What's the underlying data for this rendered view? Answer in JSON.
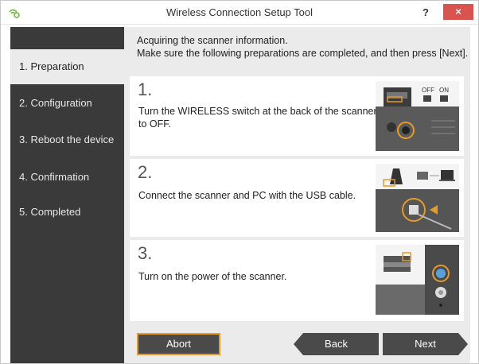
{
  "window": {
    "title": "Wireless Connection Setup Tool",
    "help_label": "?",
    "close_label": "×"
  },
  "sidebar": {
    "items": [
      {
        "label": "1. Preparation",
        "active": true
      },
      {
        "label": "2. Configuration",
        "active": false
      },
      {
        "label": "3. Reboot the device",
        "active": false
      },
      {
        "label": "4. Confirmation",
        "active": false
      },
      {
        "label": "5. Completed",
        "active": false
      }
    ]
  },
  "main": {
    "instruction_line1": "Acquiring the scanner information.",
    "instruction_line2": "Make sure the following preparations are completed, and then press [Next].",
    "steps": [
      {
        "number": "1.",
        "text": "Turn the WIRELESS switch at the back of the scanner to OFF.",
        "image_labels": {
          "off": "OFF",
          "on": "ON"
        }
      },
      {
        "number": "2.",
        "text": "Connect the scanner and PC with the USB cable."
      },
      {
        "number": "3.",
        "text": "Turn on the power of the scanner."
      }
    ]
  },
  "buttons": {
    "abort": "Abort",
    "back": "Back",
    "next": "Next"
  },
  "colors": {
    "sidebar_bg": "#3a3a3a",
    "accent_orange": "#e69a2a",
    "close_red": "#d9534f",
    "content_bg": "#ebebeb"
  }
}
